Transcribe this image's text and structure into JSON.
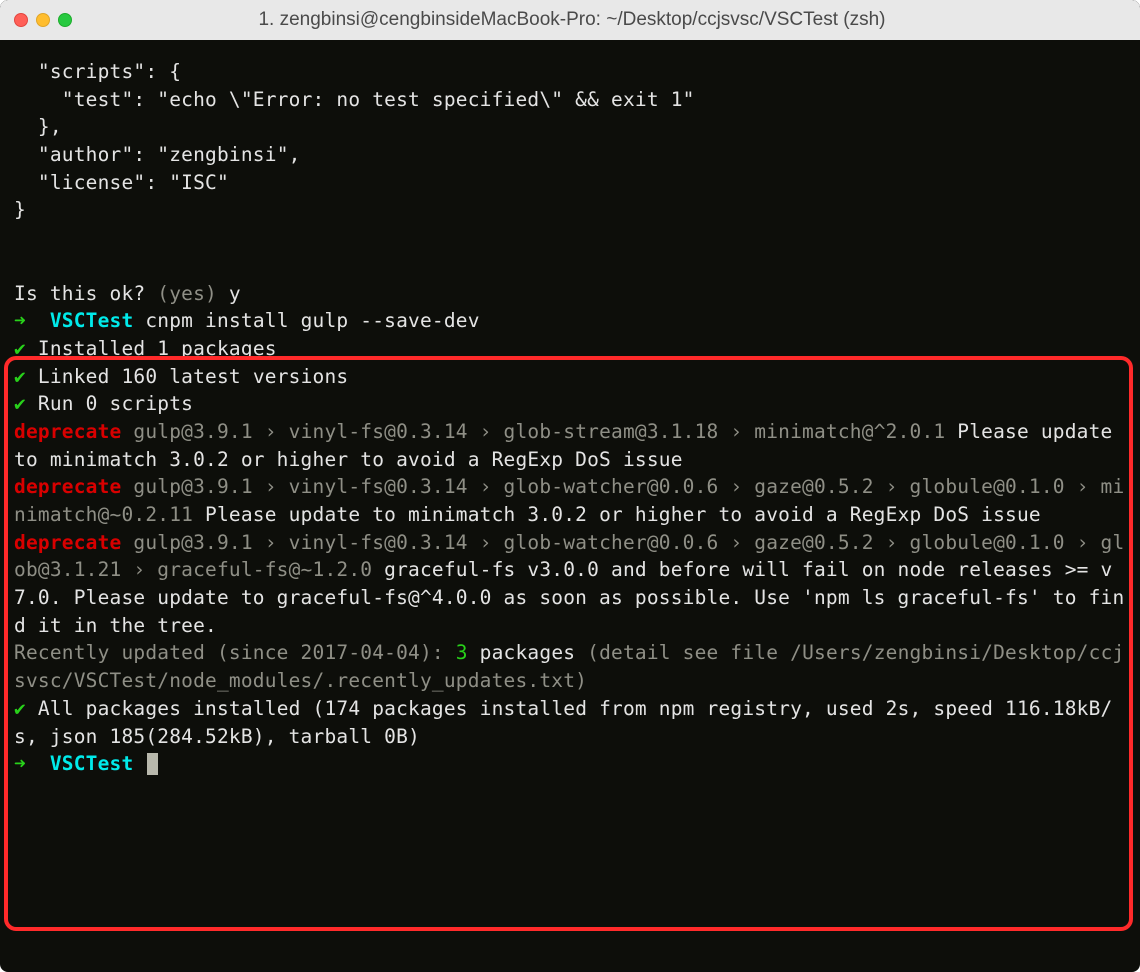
{
  "titlebar": {
    "title": "1. zengbinsi@cengbinsideMacBook-Pro: ~/Desktop/ccjsvsc/VSCTest (zsh)"
  },
  "json_snippet": {
    "scripts_key": "  \"scripts\": {",
    "test_line": "    \"test\": \"echo \\\"Error: no test specified\\\" && exit 1\"",
    "close_scripts": "  },",
    "author_line": "  \"author\": \"zengbinsi\",",
    "license_line": "  \"license\": \"ISC\"",
    "close_obj": "}"
  },
  "confirm": {
    "prompt": "Is this ok? ",
    "hint": "(yes) ",
    "answer": "y"
  },
  "prompt1": {
    "arrow": "➜  ",
    "dir": "VSCTest",
    "cmd": " cnpm install gulp --save-dev"
  },
  "status": {
    "check": "✔",
    "installed": " Installed 1 packages",
    "linked": " Linked 160 latest versions",
    "run": " Run 0 scripts"
  },
  "dep1": {
    "label": "deprecate",
    "chain": " gulp@3.9.1 › vinyl-fs@0.3.14 › glob-stream@3.1.18 › minimatch@^2.0.1 ",
    "msg": "Please update to minimatch 3.0.2 or higher to avoid a RegExp DoS issue"
  },
  "dep2": {
    "label": "deprecate",
    "chain": " gulp@3.9.1 › vinyl-fs@0.3.14 › glob-watcher@0.0.6 › gaze@0.5.2 › globule@0.1.0 › minimatch@~0.2.11 ",
    "msg": "Please update to minimatch 3.0.2 or higher to avoid a RegExp DoS issue"
  },
  "dep3": {
    "label": "deprecate",
    "chain": " gulp@3.9.1 › vinyl-fs@0.3.14 › glob-watcher@0.0.6 › gaze@0.5.2 › globule@0.1.0 › glob@3.1.21 › graceful-fs@~1.2.0 ",
    "msg": "graceful-fs v3.0.0 and before will fail on node releases >= v7.0. Please update to graceful-fs@^4.0.0 as soon as possible. Use 'npm ls graceful-fs' to find it in the tree."
  },
  "recent": {
    "prefix": "Recently updated (since 2017-04-04): ",
    "count": "3",
    "suffix": " packages",
    "detail": " (detail see file /Users/zengbinsi/Desktop/ccjsvsc/VSCTest/node_modules/.recently_updates.txt)"
  },
  "finish": {
    "check": "✔",
    "msg": " All packages installed (174 packages installed from npm registry, used 2s, speed 116.18kB/s, json 185(284.52kB), tarball 0B)"
  },
  "prompt2": {
    "arrow": "➜  ",
    "dir": "VSCTest"
  }
}
